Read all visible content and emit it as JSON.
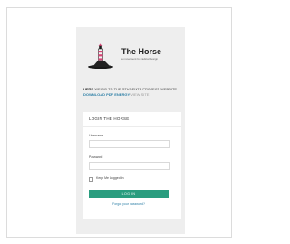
{
  "brand": {
    "name": "The Horse",
    "tagline": "a movement for radical design"
  },
  "notice": {
    "lead": "HERE",
    "text": "WE GO TO THE STUDENTS PROJECT WEBSITE",
    "link_text": "DOWNLOAD PDF ENERGY",
    "tag": "VIEW SITE"
  },
  "login_form": {
    "title": "LOGIN THE HORSE",
    "username_label": "Username",
    "username_value": "",
    "password_label": "Password",
    "password_value": "",
    "remember_label": "Keep Me Logged In",
    "submit_label": "LOG IN",
    "forgot_label": "Forgot your password?"
  },
  "colors": {
    "accent": "#2a9d7f",
    "link": "#2d7fa6",
    "panel": "#eeeeee"
  }
}
